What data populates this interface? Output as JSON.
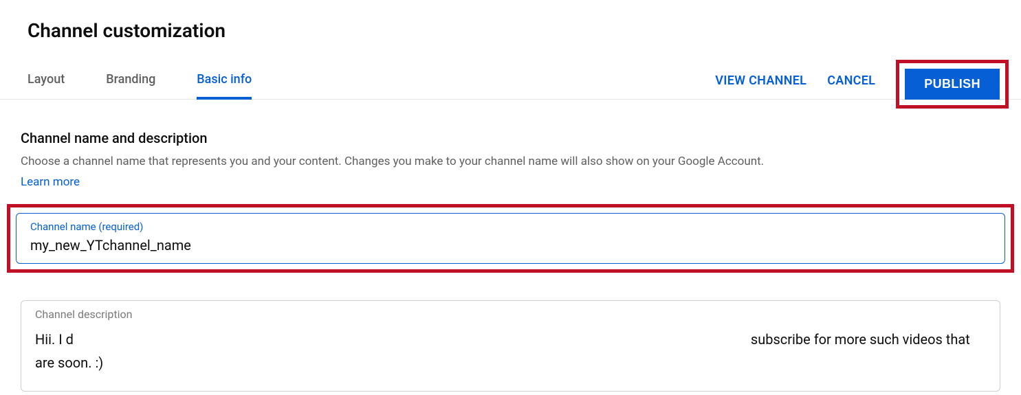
{
  "header": {
    "page_title": "Channel customization",
    "tabs": [
      {
        "label": "Layout",
        "active": false
      },
      {
        "label": "Branding",
        "active": false
      },
      {
        "label": "Basic info",
        "active": true
      }
    ],
    "actions": {
      "view_channel": "VIEW CHANNEL",
      "cancel": "CANCEL",
      "publish": "PUBLISH"
    }
  },
  "section": {
    "title": "Channel name and description",
    "help": "Choose a channel name that represents you and your content. Changes you make to your channel name will also show on your Google Account.",
    "learn_more": "Learn more"
  },
  "channel_name_field": {
    "label": "Channel name (required)",
    "value": "my_new_YTchannel_name"
  },
  "channel_description_field": {
    "label": "Channel description",
    "value_prefix": "Hii. I d",
    "value_middle_redacted": true,
    "value_suffix": " subscribe for more such videos that are                                       soon. :)"
  },
  "highlights": {
    "publish_highlighted": true,
    "channel_name_highlighted": true
  },
  "colors": {
    "accent": "#065fd4",
    "highlight": "#c10f26",
    "muted": "#606060"
  }
}
